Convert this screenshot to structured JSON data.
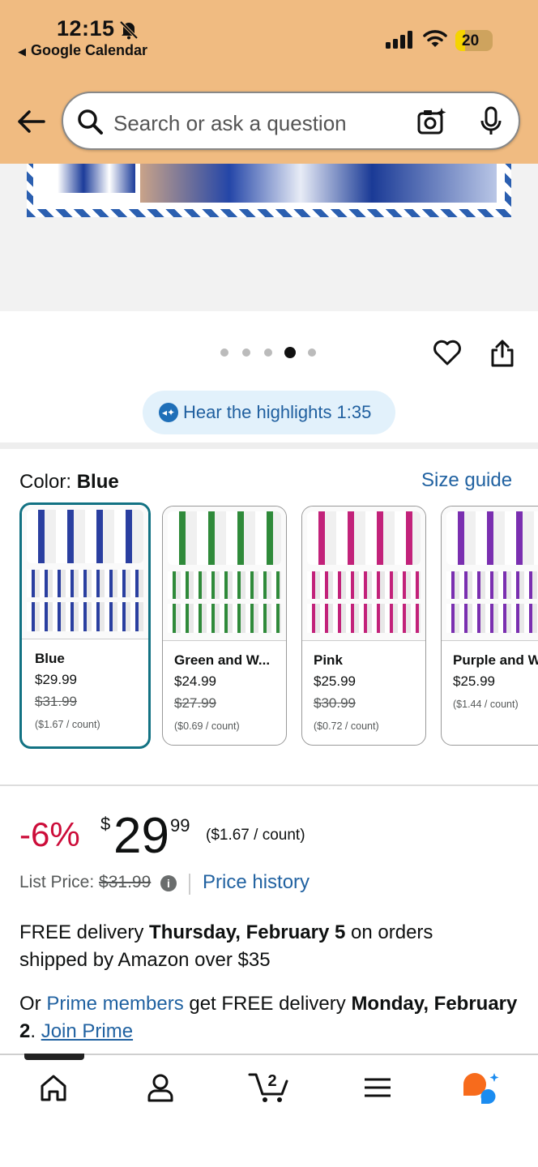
{
  "status_bar": {
    "time": "12:15",
    "back_app": "Google Calendar",
    "battery": "20"
  },
  "search": {
    "placeholder": "Search or ask a question"
  },
  "carousel": {
    "dot_count": 5,
    "active_index": 3
  },
  "highlights": {
    "label": "Hear the highlights 1:35"
  },
  "color": {
    "label": "Color: ",
    "selected": "Blue",
    "size_guide": "Size guide"
  },
  "swatches": [
    {
      "name": "Blue",
      "price": "$29.99",
      "list_price": "$31.99",
      "unit": "($1.67 / count)",
      "color": "#2a3fa0"
    },
    {
      "name": "Green and W...",
      "price": "$24.99",
      "list_price": "$27.99",
      "unit": "($0.69 / count)",
      "color": "#2f8a3a"
    },
    {
      "name": "Pink",
      "price": "$25.99",
      "list_price": "$30.99",
      "unit": "($0.72 / count)",
      "color": "#c2227a"
    },
    {
      "name": "Purple and W",
      "price": "$25.99",
      "list_price": "",
      "unit": "($1.44 / count)",
      "color": "#7a2fb0"
    }
  ],
  "price": {
    "discount": "-6%",
    "currency": "$",
    "whole": "29",
    "fraction": "99",
    "per_count": "($1.67 / count)",
    "list_price_label": "List Price: ",
    "list_price": "$31.99",
    "info": "i",
    "history": "Price history"
  },
  "delivery": {
    "prefix": "FREE delivery ",
    "date": "Thursday, February 5",
    "suffix": " on orders shipped by Amazon over $35"
  },
  "prime": {
    "prefix": "Or ",
    "members": "Prime members",
    "middle": " get FREE delivery ",
    "date": "Monday, February 2",
    "period": ". ",
    "join": "Join Prime"
  },
  "tabbar": {
    "cart_count": "2",
    "tabs": [
      "home-icon",
      "account-icon",
      "cart-icon",
      "menu-icon",
      "rufus-icon"
    ]
  },
  "colors": {
    "header_bg": "#f0bb81",
    "link": "#2162a1",
    "discount": "#cc0c39",
    "selected_border": "#127283"
  }
}
